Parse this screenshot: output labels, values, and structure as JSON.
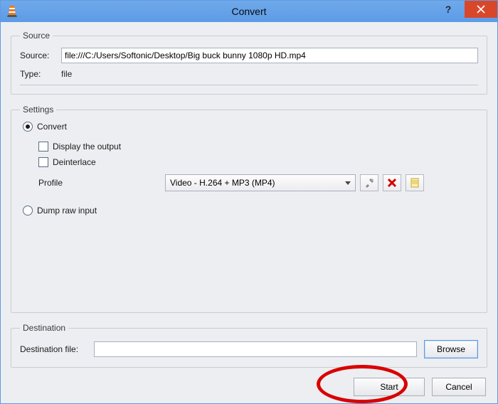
{
  "window": {
    "title": "Convert"
  },
  "source": {
    "legend": "Source",
    "source_label": "Source:",
    "source_value": "file:///C:/Users/Softonic/Desktop/Big buck bunny 1080p HD.mp4",
    "type_label": "Type:",
    "type_value": "file"
  },
  "settings": {
    "legend": "Settings",
    "convert_label": "Convert",
    "display_output_label": "Display the output",
    "deinterlace_label": "Deinterlace",
    "profile_label": "Profile",
    "profile_selected": "Video - H.264 + MP3 (MP4)",
    "dump_label": "Dump raw input"
  },
  "destination": {
    "legend": "Destination",
    "label": "Destination file:",
    "value": "",
    "browse": "Browse"
  },
  "footer": {
    "start": "Start",
    "cancel": "Cancel"
  }
}
